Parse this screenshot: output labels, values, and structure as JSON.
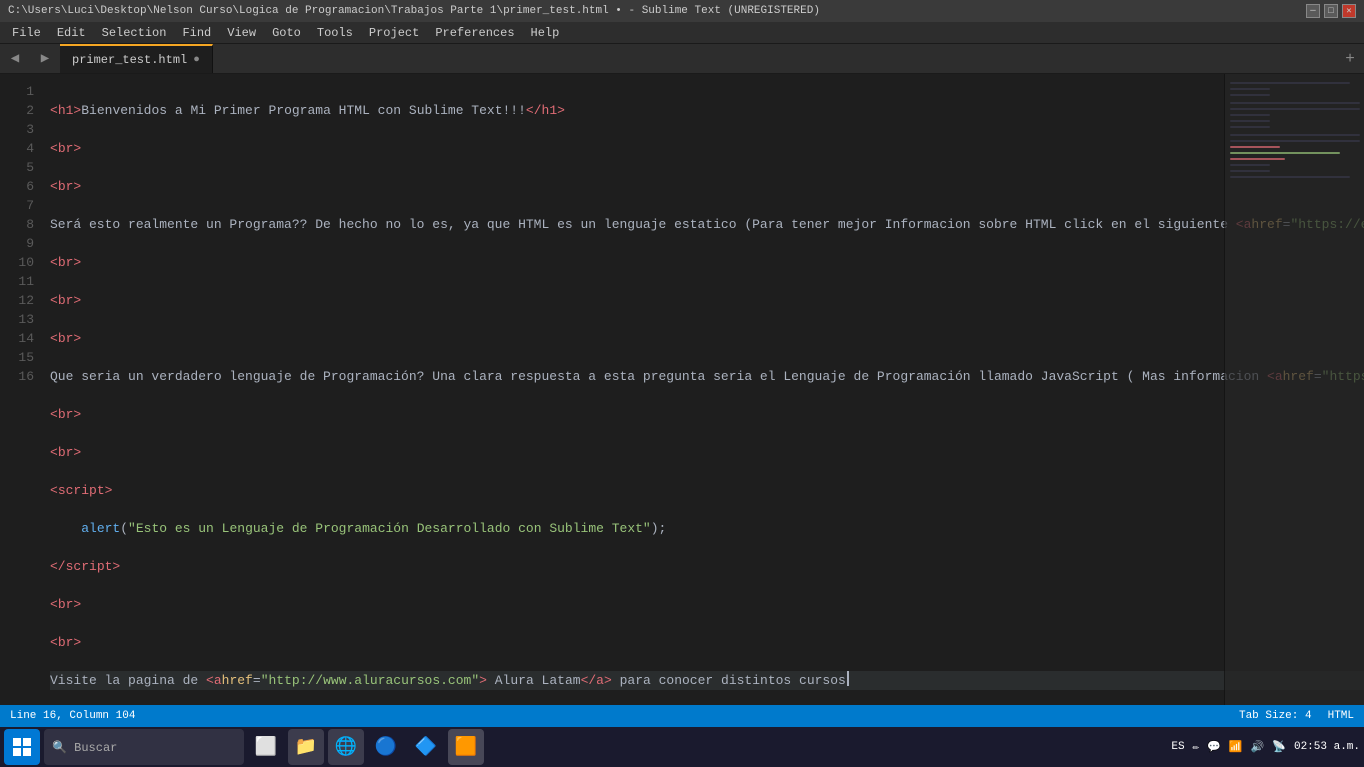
{
  "titlebar": {
    "title": "C:\\Users\\Luci\\Desktop\\Nelson Curso\\Logica de Programacion\\Trabajos Parte 1\\primer_test.html • - Sublime Text (UNREGISTERED)"
  },
  "menubar": {
    "items": [
      "File",
      "Edit",
      "Selection",
      "Find",
      "View",
      "Goto",
      "Tools",
      "Project",
      "Preferences",
      "Help"
    ]
  },
  "tab": {
    "filename": "primer_test.html"
  },
  "statusbar": {
    "left": "Line 16, Column 104",
    "tabsize": "Tab Size: 4",
    "language": "HTML"
  },
  "taskbar": {
    "language": "ES",
    "time": "02:53 a.m."
  }
}
